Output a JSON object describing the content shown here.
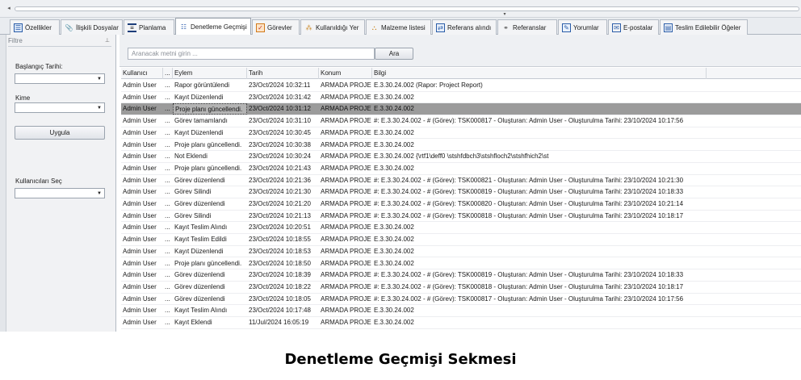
{
  "tabs": [
    {
      "label": "Özellikler",
      "icon": "properties-icon",
      "glyph": "☰",
      "cls": "ico-props",
      "active": false
    },
    {
      "label": "İlişkili Dosyalar",
      "icon": "paperclip-icon",
      "glyph": "📎",
      "cls": "ico-clip",
      "active": false
    },
    {
      "label": "Planlama",
      "icon": "planning-icon",
      "glyph": "≡",
      "cls": "ico-plan",
      "active": false
    },
    {
      "label": "Denetleme Geçmişi",
      "icon": "history-list-icon",
      "glyph": "☷",
      "cls": "ico-hist",
      "active": true
    },
    {
      "label": "Görevler",
      "icon": "tasks-icon",
      "glyph": "✓",
      "cls": "ico-task",
      "active": false
    },
    {
      "label": "Kullanıldığı Yer",
      "icon": "where-used-icon",
      "glyph": "⁂",
      "cls": "ico-where",
      "active": false
    },
    {
      "label": "Malzeme listesi",
      "icon": "bom-icon",
      "glyph": "⛬",
      "cls": "ico-mat",
      "active": false
    },
    {
      "label": "Referans alındı",
      "icon": "referenced-by-icon",
      "glyph": "⇄",
      "cls": "ico-refin",
      "active": false
    },
    {
      "label": "Referanslar",
      "icon": "references-link-icon",
      "glyph": "⚭",
      "cls": "ico-refs",
      "active": false
    },
    {
      "label": "Yorumlar",
      "icon": "comments-icon",
      "glyph": "✎",
      "cls": "ico-comm",
      "active": false
    },
    {
      "label": "E-postalar",
      "icon": "email-icon",
      "glyph": "✉",
      "cls": "ico-mail",
      "active": false
    },
    {
      "label": "Teslim Edilebilir Öğeler",
      "icon": "deliverables-icon",
      "glyph": "▤",
      "cls": "ico-deliv",
      "active": false
    }
  ],
  "filter": {
    "title": "Filtre",
    "start_date_label": "Başlangıç Tarihi:",
    "who_label": "Kime",
    "apply_label": "Uygula",
    "users_label": "Kullanıcıları Seç"
  },
  "search": {
    "placeholder": "Aranacak metni girin ...",
    "button_label": "Ara"
  },
  "table": {
    "columns": [
      "Kullanıcı",
      "...",
      "Eylem",
      "Tarih",
      "Konum",
      "Bilgi"
    ],
    "selected_row": 2,
    "rows": [
      [
        "Admin User",
        "...",
        "Rapor görüntülendi",
        "23/Oct/2024 10:32:11",
        "ARMADA PROJE",
        "E.3.30.24.002 (Rapor:  Project Report)"
      ],
      [
        "Admin User",
        "...",
        "Kayıt Düzenlendi",
        "23/Oct/2024 10:31:42",
        "ARMADA PROJE",
        "E.3.30.24.002"
      ],
      [
        "Admin User",
        "...",
        "Proje planı güncellendi.",
        "23/Oct/2024 10:31:12",
        "ARMADA PROJE",
        "E.3.30.24.002"
      ],
      [
        "Admin User",
        "...",
        "Görev tamamlandı",
        "23/Oct/2024 10:31:10",
        "ARMADA PROJE",
        "#: E.3.30.24.002 - # (Görev): TSK000817 - Oluşturan: Admin User - Oluşturulma Tarihi: 23/10/2024 10:17:56"
      ],
      [
        "Admin User",
        "...",
        "Kayıt Düzenlendi",
        "23/Oct/2024 10:30:45",
        "ARMADA PROJE",
        "E.3.30.24.002"
      ],
      [
        "Admin User",
        "...",
        "Proje planı güncellendi.",
        "23/Oct/2024 10:30:38",
        "ARMADA PROJE",
        "E.3.30.24.002"
      ],
      [
        "Admin User",
        "...",
        "Not Eklendi",
        "23/Oct/2024 10:30:24",
        "ARMADA PROJE",
        "E.3.30.24.002 {\\rtf1\\deff0 \\stshfdbch3\\stshfloch2\\stshfhich2\\st"
      ],
      [
        "Admin User",
        "...",
        "Proje planı güncellendi.",
        "23/Oct/2024 10:21:43",
        "ARMADA PROJE",
        "E.3.30.24.002"
      ],
      [
        "Admin User",
        "...",
        "Görev düzenlendi",
        "23/Oct/2024 10:21:36",
        "ARMADA PROJE",
        "#: E.3.30.24.002 - # (Görev): TSK000821 - Oluşturan: Admin User - Oluşturulma Tarihi: 23/10/2024 10:21:30"
      ],
      [
        "Admin User",
        "...",
        "Görev Silindi",
        "23/Oct/2024 10:21:30",
        "ARMADA PROJE",
        "#: E.3.30.24.002 - # (Görev): TSK000819 - Oluşturan: Admin User - Oluşturulma Tarihi: 23/10/2024 10:18:33"
      ],
      [
        "Admin User",
        "...",
        "Görev düzenlendi",
        "23/Oct/2024 10:21:20",
        "ARMADA PROJE",
        "#: E.3.30.24.002 - # (Görev): TSK000820 - Oluşturan: Admin User - Oluşturulma Tarihi: 23/10/2024 10:21:14"
      ],
      [
        "Admin User",
        "...",
        "Görev Silindi",
        "23/Oct/2024 10:21:13",
        "ARMADA PROJE",
        "#: E.3.30.24.002 - # (Görev): TSK000818 - Oluşturan: Admin User - Oluşturulma Tarihi: 23/10/2024 10:18:17"
      ],
      [
        "Admin User",
        "...",
        "Kayıt Teslim Alındı",
        "23/Oct/2024 10:20:51",
        "ARMADA PROJE",
        "E.3.30.24.002"
      ],
      [
        "Admin User",
        "...",
        "Kayıt Teslim Edildi",
        "23/Oct/2024 10:18:55",
        "ARMADA PROJE",
        "E.3.30.24.002"
      ],
      [
        "Admin User",
        "...",
        "Kayıt Düzenlendi",
        "23/Oct/2024 10:18:53",
        "ARMADA PROJE",
        "E.3.30.24.002"
      ],
      [
        "Admin User",
        "...",
        "Proje planı güncellendi.",
        "23/Oct/2024 10:18:50",
        "ARMADA PROJE",
        "E.3.30.24.002"
      ],
      [
        "Admin User",
        "...",
        "Görev düzenlendi",
        "23/Oct/2024 10:18:39",
        "ARMADA PROJE",
        "#: E.3.30.24.002 - # (Görev): TSK000819 - Oluşturan: Admin User - Oluşturulma Tarihi: 23/10/2024 10:18:33"
      ],
      [
        "Admin User",
        "...",
        "Görev düzenlendi",
        "23/Oct/2024 10:18:22",
        "ARMADA PROJE",
        "#: E.3.30.24.002 - # (Görev): TSK000818 - Oluşturan: Admin User - Oluşturulma Tarihi: 23/10/2024 10:18:17"
      ],
      [
        "Admin User",
        "...",
        "Görev düzenlendi",
        "23/Oct/2024 10:18:05",
        "ARMADA PROJE",
        "#: E.3.30.24.002 - # (Görev): TSK000817 - Oluşturan: Admin User - Oluşturulma Tarihi: 23/10/2024 10:17:56"
      ],
      [
        "Admin User",
        "...",
        "Kayıt Teslim Alındı",
        "23/Oct/2024 10:17:48",
        "ARMADA PROJE",
        "E.3.30.24.002"
      ],
      [
        "Admin User",
        "...",
        "Kayıt Eklendi",
        "11/Jul/2024 16:05:19",
        "ARMADA PROJE",
        "E.3.30.24.002"
      ]
    ]
  },
  "caption": "Denetleme Geçmişi Sekmesi"
}
